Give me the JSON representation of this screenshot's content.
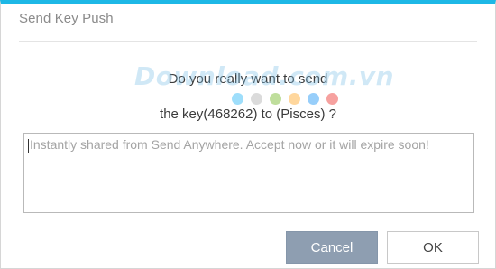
{
  "dialog": {
    "title": "Send Key Push",
    "message_line1": "Do you really want to send",
    "message_line2": "the key(468262) to (Pisces) ?",
    "message_box": {
      "value": "Instantly shared from Send Anywhere. Accept now or it will expire soon!"
    },
    "buttons": {
      "cancel": "Cancel",
      "ok": "OK"
    }
  },
  "watermark": {
    "text": "Download.com.vn",
    "dot_colors": [
      "#4fc3f7",
      "#bdbdbd",
      "#8bc34a",
      "#ffb74d",
      "#42a5f5",
      "#ef5350"
    ]
  },
  "colors": {
    "accent_top_bar": "#1db8e6",
    "cancel_button": "#8e9eb1"
  }
}
